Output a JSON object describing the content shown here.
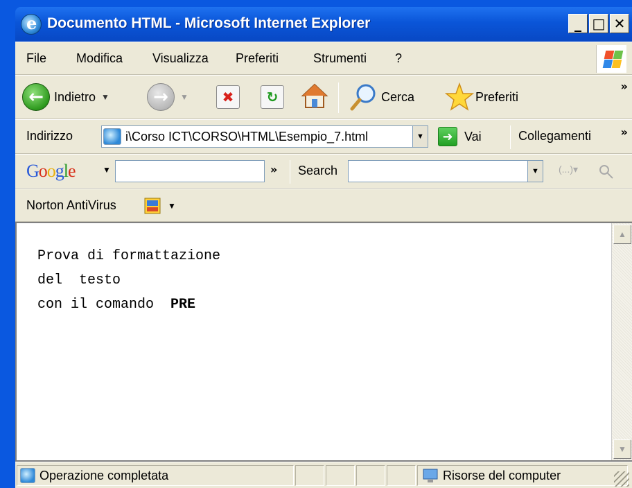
{
  "window": {
    "title": "Documento HTML - Microsoft Internet Explorer",
    "buttons": {
      "minimize": "_",
      "maximize": "□",
      "close": "✕"
    }
  },
  "menu": {
    "items": [
      "File",
      "Modifica",
      "Visualizza",
      "Preferiti",
      "Strumenti",
      "?"
    ]
  },
  "toolbar": {
    "back_label": "Indietro",
    "search_label": "Cerca",
    "favorites_label": "Preferiti",
    "more": "»"
  },
  "addressbar": {
    "label": "Indirizzo",
    "value": "i\\Corso ICT\\CORSO\\HTML\\Esempio_7.html",
    "go_label": "Vai",
    "links_label": "Collegamenti",
    "more": "»"
  },
  "googlebar": {
    "logo": "Google",
    "search_query": "",
    "more": "»",
    "search_label": "Search",
    "search_value": ""
  },
  "nortonbar": {
    "label": "Norton AntiVirus"
  },
  "page": {
    "line1": "Prova di formattazione",
    "line2": "del  testo",
    "line3_prefix": "con il comando  ",
    "line3_bold": "PRE"
  },
  "status": {
    "text": "Operazione completata",
    "zone": "Risorse del computer"
  },
  "colors": {
    "title_bar": "#0a55d8",
    "chrome": "#ece9d8",
    "go_green": "#22a023"
  }
}
